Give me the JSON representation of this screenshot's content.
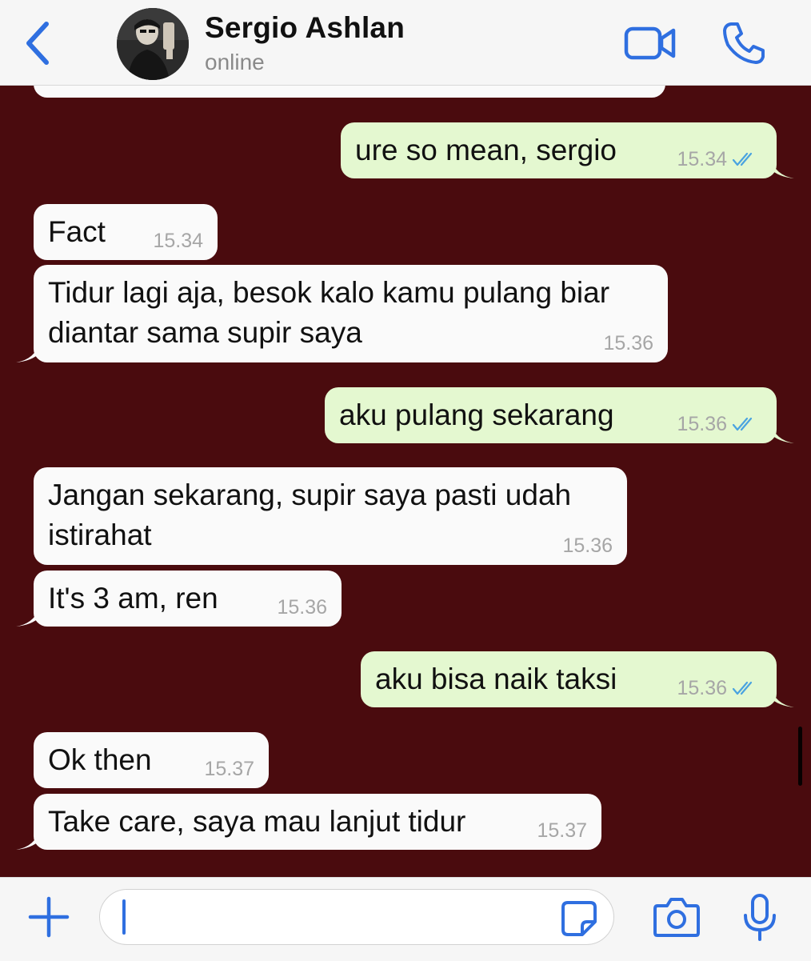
{
  "colors": {
    "accent": "#2f6fe0",
    "chat_background": "#4a0b0e",
    "incoming_bubble": "#fafafa",
    "outgoing_bubble": "#e4f8d0",
    "read_receipt": "#4aa3e0",
    "timestamp": "#a6a6a6"
  },
  "header": {
    "back_icon": "chevron-left-icon",
    "contact_name": "Sergio Ashlan",
    "status": "online",
    "video_icon": "video-camera-icon",
    "call_icon": "phone-icon"
  },
  "messages": [
    {
      "dir": "in",
      "text": "Fact",
      "time": "15.34"
    },
    {
      "dir": "out",
      "text": "ure so mean, sergio",
      "time": "15.34",
      "read": true
    },
    {
      "dir": "in",
      "text": "Tidur lagi aja, besok kalo kamu pulang biar diantar sama supir saya",
      "time": "15.36"
    },
    {
      "dir": "out",
      "text": "aku pulang sekarang",
      "time": "15.36",
      "read": true
    },
    {
      "dir": "in",
      "text": "Jangan sekarang, supir saya pasti udah istirahat",
      "time": "15.36"
    },
    {
      "dir": "in",
      "text": "It's 3 am, ren",
      "time": "15.36"
    },
    {
      "dir": "out",
      "text": "aku bisa naik taksi",
      "time": "15.36",
      "read": true
    },
    {
      "dir": "in",
      "text": "Ok then",
      "time": "15.37"
    },
    {
      "dir": "in",
      "text": "Take care, saya mau lanjut tidur",
      "time": "15.37"
    }
  ],
  "input_bar": {
    "plus_icon": "plus-icon",
    "message_value": "",
    "sticker_icon": "sticker-icon",
    "camera_icon": "camera-icon",
    "mic_icon": "microphone-icon"
  }
}
